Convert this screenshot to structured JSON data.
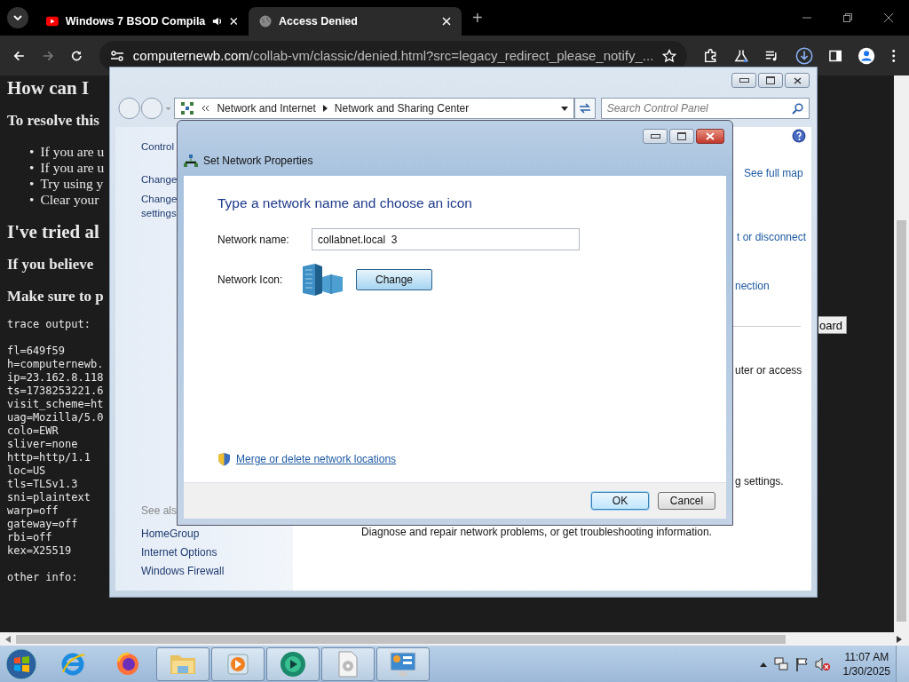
{
  "browser": {
    "tabs": [
      {
        "title": "Windows 7 BSOD Compila",
        "kind": "video",
        "audio": true,
        "selected": false
      },
      {
        "title": "Access Denied",
        "kind": "page",
        "audio": false,
        "selected": true
      }
    ],
    "new_tab": "+",
    "address": {
      "host": "computernewb.com",
      "path": "/collab-vm/classic/denied.html?src=legacy_redirect_please_notify_..."
    }
  },
  "page": {
    "heading": "How can I",
    "subheading": "To resolve this",
    "bullet": "•",
    "bullets": [
      "If you are u",
      "If you are u",
      "Try using y",
      "Clear your"
    ],
    "heading_2": "I've tried al",
    "notes": [
      "If you believe",
      "Make sure to p"
    ],
    "button": "oard",
    "trace_title": "trace output:",
    "trace_lines": [
      "fl=649f59",
      "h=computernewb.",
      "ip=23.162.8.118",
      "ts=1738253221.6",
      "visit_scheme=ht",
      "uag=Mozilla/5.0",
      "colo=EWR",
      "sliver=none",
      "http=http/1.1",
      "loc=US",
      "tls=TLSv1.3",
      "sni=plaintext",
      "warp=off",
      "gateway=off",
      "rbi=off",
      "kex=X25519"
    ],
    "other_info": "other info:"
  },
  "control_panel": {
    "breadcrumb": [
      "Network and Internet",
      "Network and Sharing Center"
    ],
    "search": {
      "placeholder": "Search Control Panel"
    },
    "sidebar": [
      "Control",
      "Change",
      "Change settings"
    ],
    "see_also": {
      "title": "See als",
      "items": [
        "HomeGroup",
        "Internet Options",
        "Windows Firewall"
      ]
    },
    "links": [
      "See full map",
      "t or disconnect",
      "nection"
    ],
    "texts": [
      "uter or access",
      "g settings."
    ],
    "description": "Diagnose and repair network problems, or get troubleshooting information."
  },
  "dialog": {
    "title": "Set Network Properties",
    "heading": "Type a network name and choose an icon",
    "name_label": "Network name:",
    "name_value": "collabnet.local  3",
    "icon_label": "Network Icon:",
    "change_button": "Change",
    "link": "Merge or delete network locations",
    "buttons": [
      {
        "label": "OK",
        "default": true
      },
      {
        "label": "Cancel",
        "default": false
      }
    ]
  },
  "taskbar": {
    "apps": [
      {
        "kind": "ie",
        "running": false
      },
      {
        "kind": "firefox",
        "running": false
      },
      {
        "kind": "folder",
        "running": true
      },
      {
        "kind": "media",
        "running": true
      },
      {
        "kind": "disc",
        "running": true
      },
      {
        "kind": "drive",
        "running": true
      },
      {
        "kind": "network",
        "running": true
      }
    ],
    "time": "11:07 AM",
    "date": "1/30/2025"
  }
}
